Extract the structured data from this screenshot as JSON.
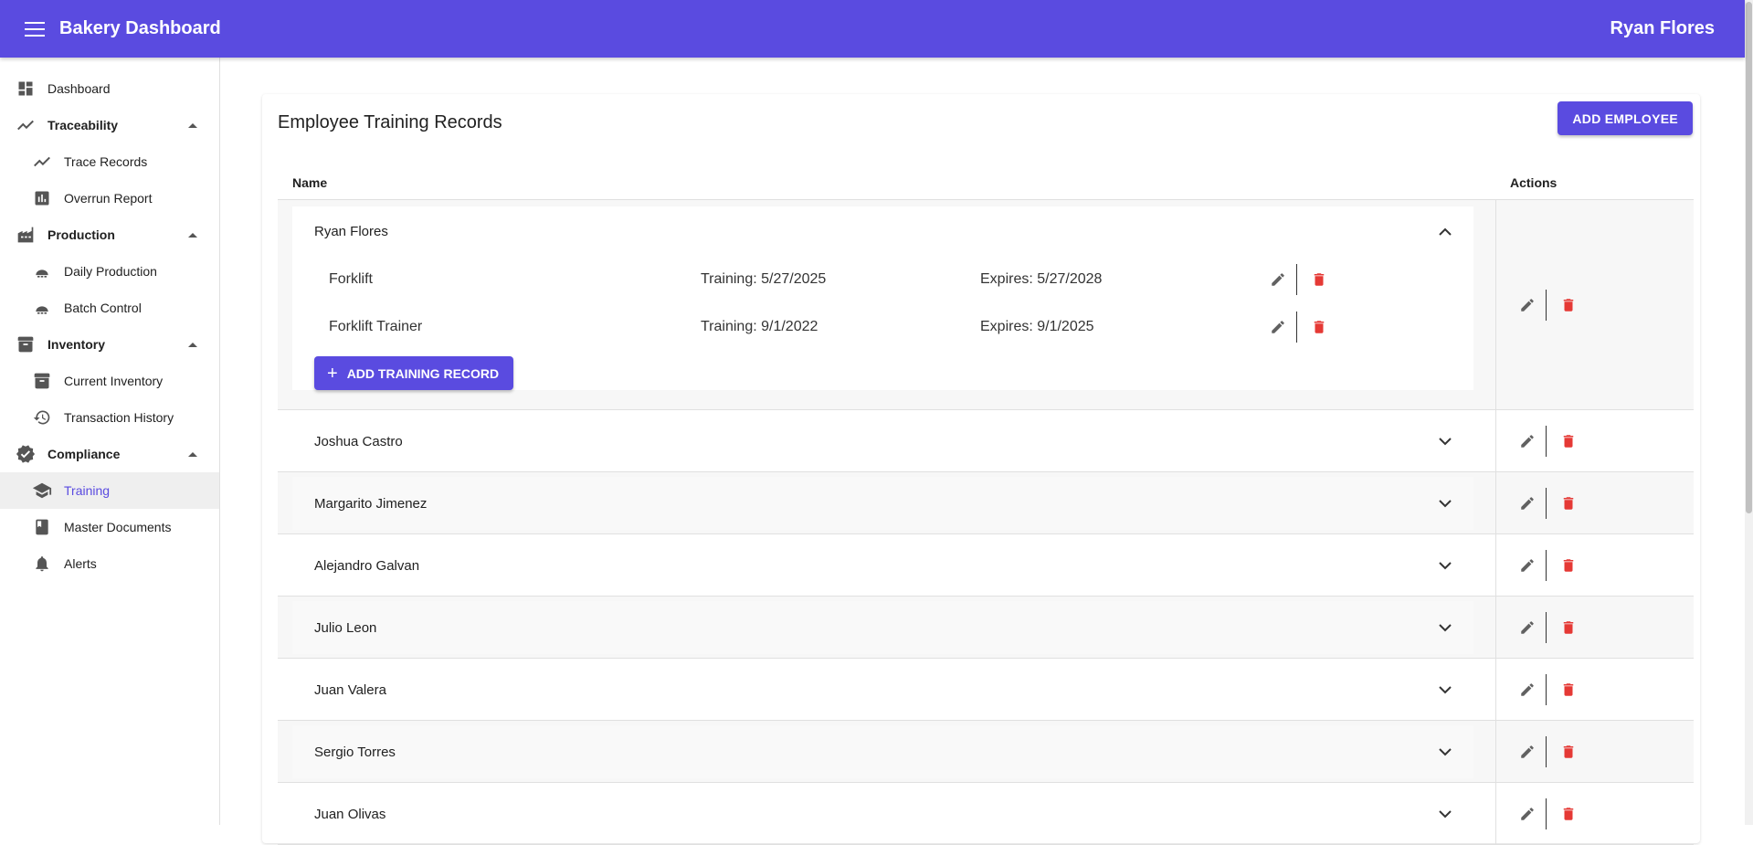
{
  "app": {
    "title": "Bakery Dashboard",
    "user": "Ryan Flores"
  },
  "sidebar": {
    "items": [
      {
        "label": "Dashboard",
        "icon": "dashboard-icon",
        "level": "top"
      },
      {
        "label": "Traceability",
        "icon": "trending-icon",
        "level": "group"
      },
      {
        "label": "Trace Records",
        "icon": "trending-icon",
        "level": "sub"
      },
      {
        "label": "Overrun Report",
        "icon": "bar-chart-icon",
        "level": "sub"
      },
      {
        "label": "Production",
        "icon": "factory-icon",
        "level": "group"
      },
      {
        "label": "Daily Production",
        "icon": "bakery-icon",
        "level": "sub"
      },
      {
        "label": "Batch Control",
        "icon": "bakery-icon",
        "level": "sub"
      },
      {
        "label": "Inventory",
        "icon": "archive-icon",
        "level": "group"
      },
      {
        "label": "Current Inventory",
        "icon": "archive-icon",
        "level": "sub"
      },
      {
        "label": "Transaction History",
        "icon": "history-icon",
        "level": "sub"
      },
      {
        "label": "Compliance",
        "icon": "verified-icon",
        "level": "group"
      },
      {
        "label": "Training",
        "icon": "school-icon",
        "level": "sub",
        "active": true
      },
      {
        "label": "Master Documents",
        "icon": "book-icon",
        "level": "sub"
      },
      {
        "label": "Alerts",
        "icon": "bell-icon",
        "level": "sub"
      }
    ]
  },
  "main": {
    "title": "Employee Training Records",
    "add_employee": "ADD EMPLOYEE",
    "columns": {
      "name": "Name",
      "actions": "Actions"
    },
    "expanded": {
      "name": "Ryan Flores",
      "records": [
        {
          "course": "Forklift",
          "training": "Training: 5/27/2025",
          "expires": "Expires: 5/27/2028"
        },
        {
          "course": "Forklift Trainer",
          "training": "Training: 9/1/2022",
          "expires": "Expires: 9/1/2025"
        }
      ],
      "add_record": "ADD TRAINING RECORD"
    },
    "employees": [
      "Joshua Castro",
      "Margarito Jimenez",
      "Alejandro Galvan",
      "Julio Leon",
      "Juan Valera",
      "Sergio Torres",
      "Juan Olivas"
    ]
  },
  "colors": {
    "primary": "#5a4be0",
    "delete": "#e53935",
    "edit": "#616161"
  }
}
